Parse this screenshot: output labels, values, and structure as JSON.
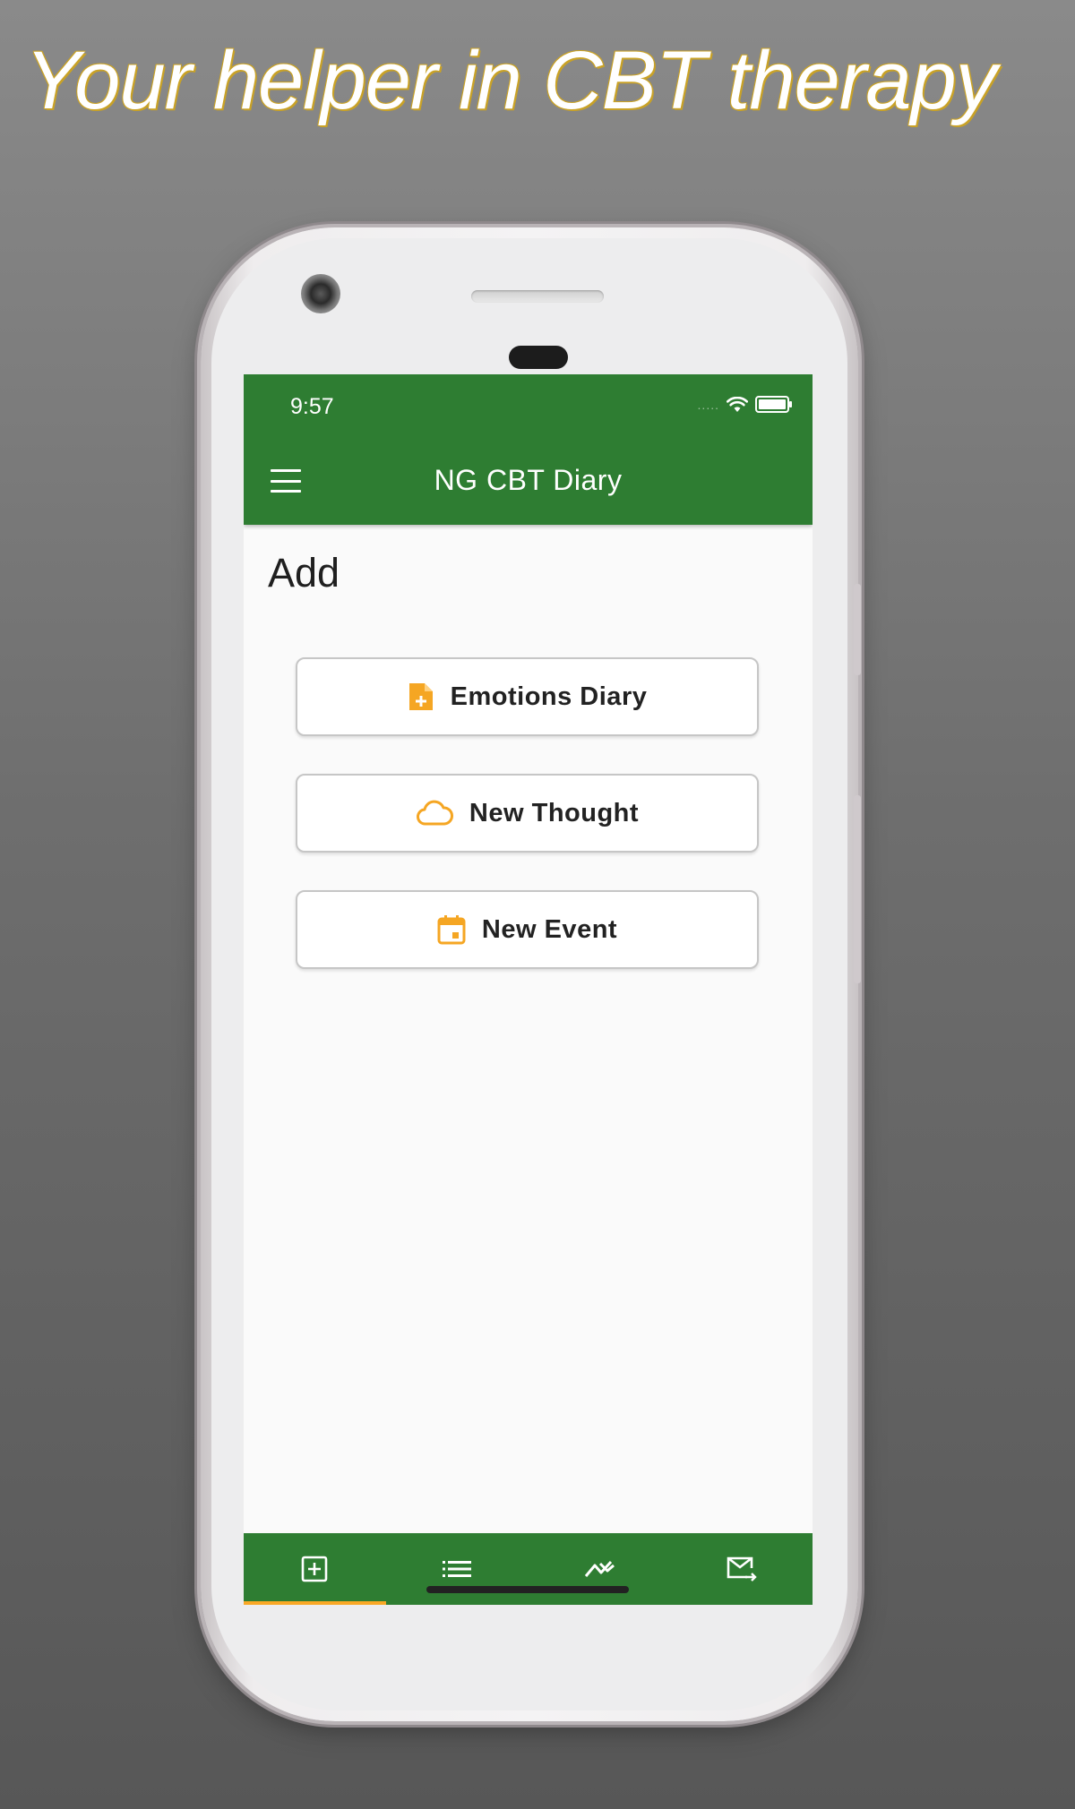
{
  "promo": {
    "headline": "Your helper in CBT therapy"
  },
  "status_bar": {
    "time": "9:57",
    "signal_dots": "....."
  },
  "app_bar": {
    "title": "NG CBT Diary",
    "menu_icon": "hamburger-menu-icon"
  },
  "page": {
    "title": "Add"
  },
  "actions": [
    {
      "label": "Emotions Diary",
      "icon": "note-add-icon"
    },
    {
      "label": "New Thought",
      "icon": "cloud-icon"
    },
    {
      "label": "New Event",
      "icon": "calendar-icon"
    }
  ],
  "bottom_nav": [
    {
      "icon": "add-box-icon",
      "active": true
    },
    {
      "icon": "list-icon",
      "active": false
    },
    {
      "icon": "trending-chart-icon",
      "active": false
    },
    {
      "icon": "mail-send-icon",
      "active": false
    }
  ],
  "colors": {
    "primary": "#2e7d32",
    "accent": "#f9a825",
    "icon_orange": "#f5a623"
  }
}
